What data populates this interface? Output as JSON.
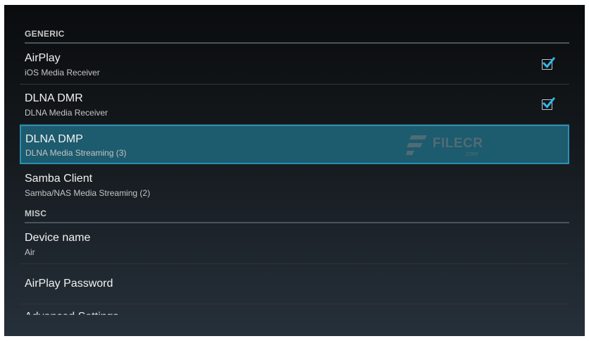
{
  "sections": {
    "generic": "GENERIC",
    "misc": "MISC"
  },
  "items": {
    "airplay": {
      "title": "AirPlay",
      "summary": "iOS Media Receiver",
      "checked": true
    },
    "dlna_dmr": {
      "title": "DLNA DMR",
      "summary": "DLNA Media Receiver",
      "checked": true
    },
    "dlna_dmp": {
      "title": "DLNA DMP",
      "summary": "DLNA Media Streaming (3)",
      "selected": true
    },
    "samba": {
      "title": "Samba Client",
      "summary": "Samba/NAS Media Streaming (2)"
    },
    "device_name": {
      "title": "Device name",
      "summary": "Air"
    },
    "airplay_password": {
      "title": "AirPlay Password"
    },
    "advanced": {
      "title": "Advanced Settings"
    }
  },
  "watermark": {
    "text": "FILECR",
    "suffix": ".com"
  },
  "colors": {
    "selected_bg": "#1d5b6e",
    "selected_border": "#2a8fb3",
    "checkmark": "#33b5e5"
  },
  "icons": {
    "checkbox": "checkmark-icon",
    "watermark": "filecr-logo-icon"
  }
}
